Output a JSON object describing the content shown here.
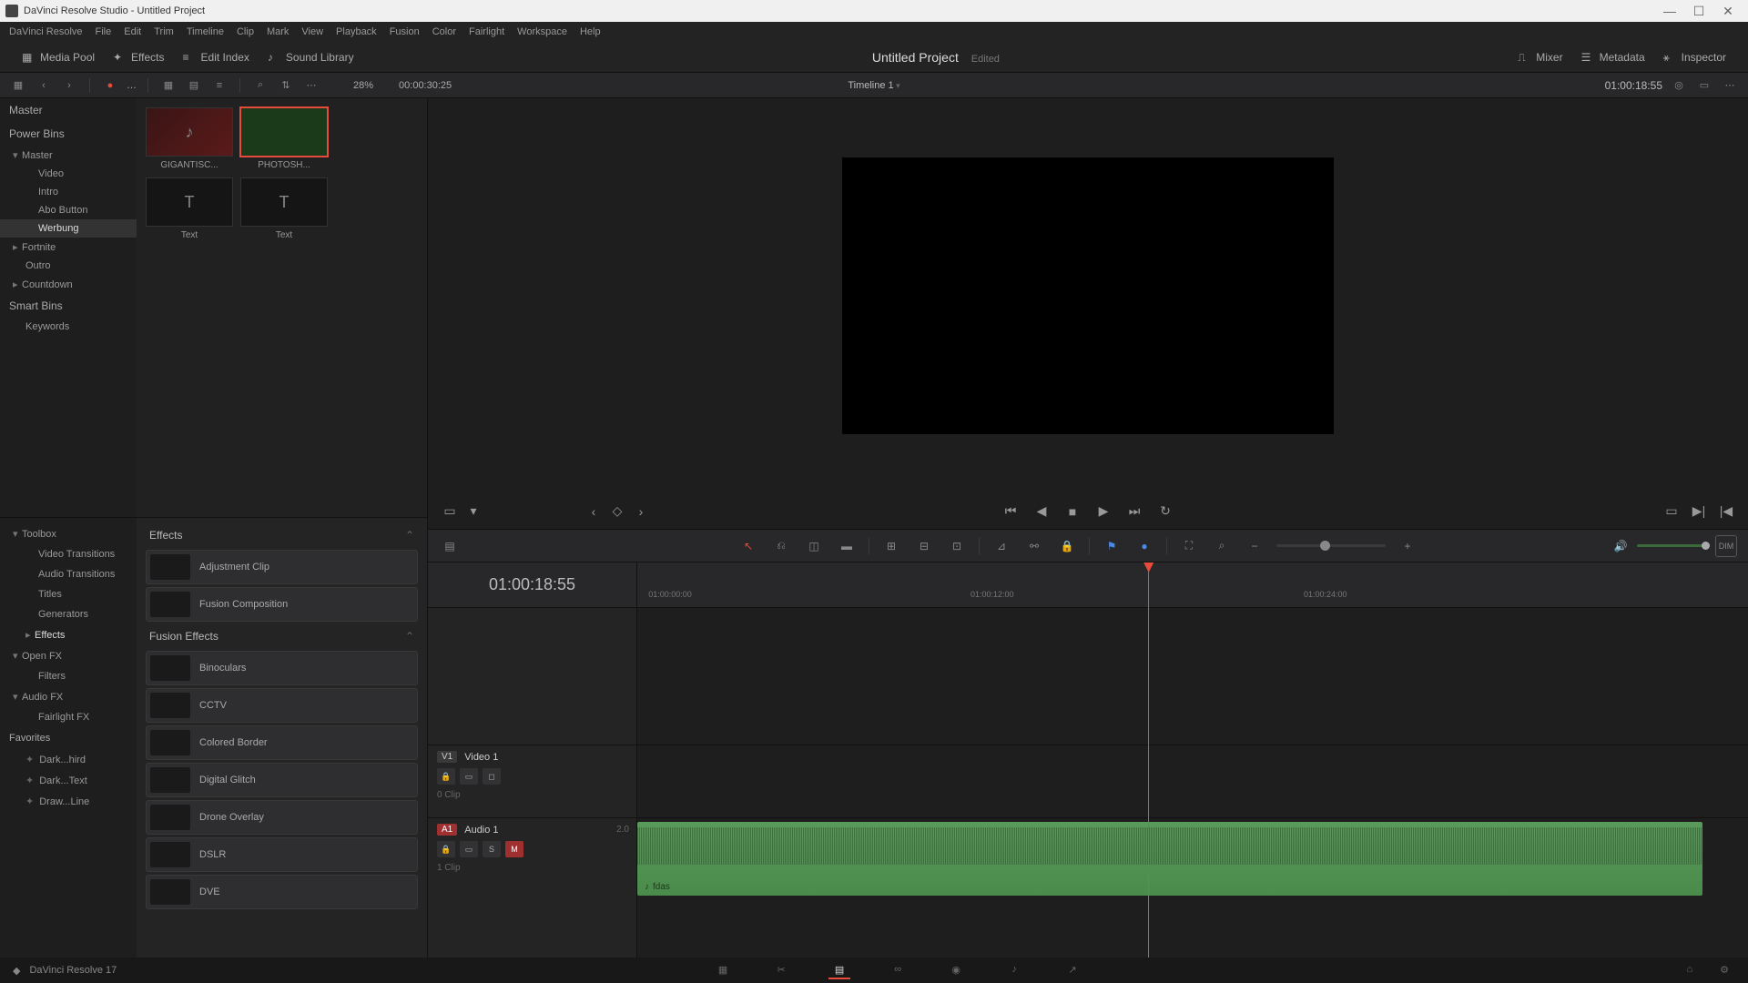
{
  "window": {
    "title": "DaVinci Resolve Studio - Untitled Project"
  },
  "menubar": [
    "DaVinci Resolve",
    "File",
    "Edit",
    "Trim",
    "Timeline",
    "Clip",
    "Mark",
    "View",
    "Playback",
    "Fusion",
    "Color",
    "Fairlight",
    "Workspace",
    "Help"
  ],
  "toptabs": {
    "media_pool": "Media Pool",
    "effects": "Effects",
    "edit_index": "Edit Index",
    "sound_library": "Sound Library",
    "mixer": "Mixer",
    "metadata": "Metadata",
    "inspector": "Inspector"
  },
  "project": {
    "name": "Untitled Project",
    "status": "Edited"
  },
  "subtoolbar": {
    "zoom_pct": "28%",
    "source_tc": "00:00:30:25",
    "timeline_name": "Timeline 1",
    "timeline_tc": "01:00:18:55"
  },
  "bins": {
    "master": "Master",
    "power_bins": "Power Bins",
    "pb_items": [
      {
        "label": "Master",
        "expand": true,
        "children": [
          {
            "label": "Video"
          },
          {
            "label": "Intro"
          },
          {
            "label": "Abo Button"
          },
          {
            "label": "Werbung",
            "active": true
          }
        ]
      },
      {
        "label": "Fortnite",
        "expand": false
      },
      {
        "label": "Outro"
      },
      {
        "label": "Countdown",
        "expand": false
      }
    ],
    "smart_bins": "Smart Bins",
    "sb_items": [
      {
        "label": "Keywords"
      }
    ]
  },
  "clips": [
    {
      "name": "GIGANTISC...",
      "kind": "audio"
    },
    {
      "name": "PHOTOSH...",
      "kind": "video",
      "selected": true
    },
    {
      "name": "Text",
      "kind": "title"
    },
    {
      "name": "Text",
      "kind": "title"
    }
  ],
  "fxcats": {
    "toolbox": "Toolbox",
    "toolbox_items": [
      "Video Transitions",
      "Audio Transitions",
      "Titles",
      "Generators",
      "Effects"
    ],
    "openfx": "Open FX",
    "openfx_items": [
      "Filters"
    ],
    "audiofx": "Audio FX",
    "audiofx_items": [
      "Fairlight FX"
    ],
    "favorites": "Favorites",
    "fav_items": [
      "Dark...hird",
      "Dark...Text",
      "Draw...Line"
    ]
  },
  "fxlist": {
    "group1": "Effects",
    "group1_items": [
      "Adjustment Clip",
      "Fusion Composition"
    ],
    "group2": "Fusion Effects",
    "group2_items": [
      "Binoculars",
      "CCTV",
      "Colored Border",
      "Digital Glitch",
      "Drone Overlay",
      "DSLR",
      "DVE"
    ]
  },
  "timeline": {
    "tc": "01:00:18:55",
    "ruler": [
      "01:00:00:00",
      "01:00:12:00",
      "01:00:24:00"
    ],
    "video_track": {
      "id": "V1",
      "name": "Video 1",
      "clips": "0 Clip"
    },
    "audio_track": {
      "id": "A1",
      "name": "Audio 1",
      "ch": "2.0",
      "clips": "1 Clip"
    },
    "audio_clip_label": "fdas",
    "playhead_pct": 46
  },
  "bottombar": {
    "version": "DaVinci Resolve 17"
  }
}
